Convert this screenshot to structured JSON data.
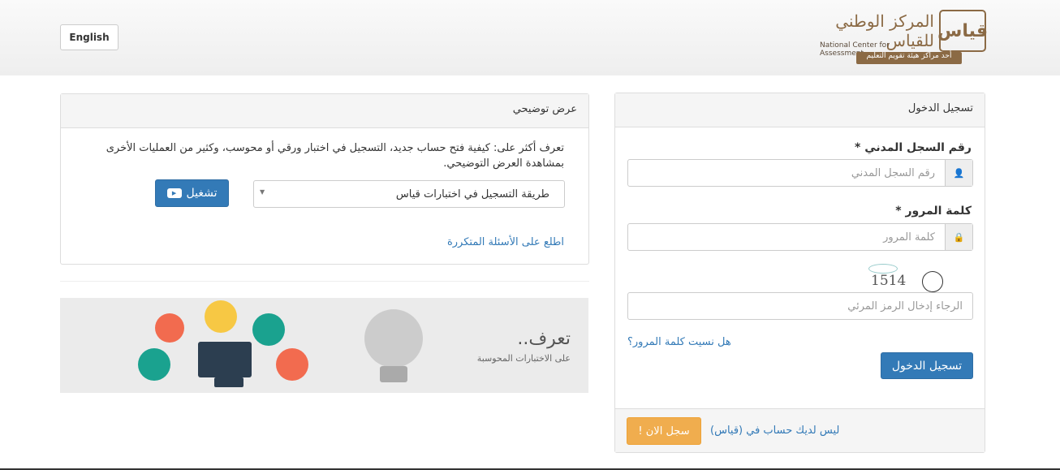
{
  "header": {
    "language_button": "English",
    "logo": {
      "arabic": "المركز الوطني للقياس",
      "english": "National Center for Assessment",
      "tagline": "أحد مراكز هيئة تقويم التعليم",
      "mark": "قياس"
    }
  },
  "login": {
    "title": "تسجيل الدخول",
    "id_label": "رقم السجل المدني *",
    "id_placeholder": "رقم السجل المدني",
    "password_label": "كلمة المرور *",
    "password_placeholder": "كلمة المرور",
    "captcha_text": "1514",
    "captcha_placeholder": "الرجاء إدخال الرمز المرئي",
    "forgot_link": "هل نسيت كلمة المرور؟",
    "submit_button": "تسجيل الدخول",
    "no_account_text": "ليس لديك حساب في (قياس)",
    "register_button": "سجل الان !"
  },
  "demo": {
    "title": "عرض توضيحي",
    "description": "تعرف أكثر على: كيفية فتح حساب جديد، التسجيل في اختبار ورقي أو محوسب، وكثير من العمليات الأخرى بمشاهدة العرض التوضيحي.",
    "select_value": "طريقة التسجيل في اختبارات قياس",
    "play_button": "تشغيل",
    "faq_link": "اطلع على الأسئلة المتكررة"
  },
  "banner": {
    "title": "تعرف..",
    "subtitle": "على الاختبارات المحوسبة"
  },
  "colors": {
    "primary": "#337ab7",
    "warning": "#f0ad4e",
    "brand": "#8b6a45"
  }
}
